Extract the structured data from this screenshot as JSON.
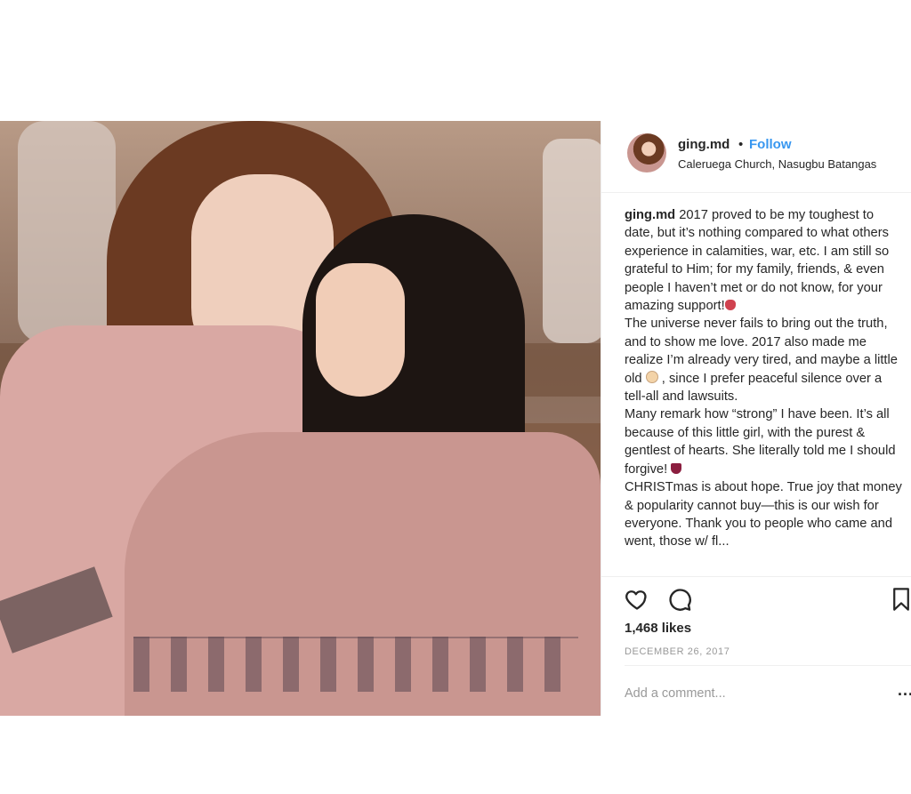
{
  "post": {
    "username": "ging.md",
    "separator": "•",
    "follow_label": "Follow",
    "location": "Caleruega Church, Nasugbu Batangas",
    "caption": {
      "username": "ging.md",
      "p1": "2017 proved to be my toughest to date, but it’s nothing compared to what others experience in calamities, war, etc. I am still so grateful to Him; for my family, friends, & even people I haven’t met or do not know, for your amazing support!",
      "p2": "The universe never fails to bring out the truth, and to show me love. 2017 also made me realize I’m already very tired, and maybe a little old",
      "p3": ", since I prefer peaceful silence over a tell-all and lawsuits.",
      "p4": "Many remark how “strong” I have been. It’s all because of this little girl, with the purest & gentlest of hearts. She literally told me I should forgive!",
      "p5": "CHRISTmas is about hope. True joy that money & popularity cannot buy—this is our wish for everyone. Thank you to people who came and went, those w/ fl..."
    },
    "likes": "1,468 likes",
    "date": "DECEMBER 26, 2017",
    "comment_placeholder": "Add a comment...",
    "more_label": "..."
  },
  "icons": {
    "heart": "heart-icon",
    "comment": "comment-icon",
    "save": "bookmark-icon",
    "more": "more-options-icon"
  },
  "colors": {
    "link": "#3897f0",
    "text": "#262626",
    "muted": "#999999",
    "divider": "#efefef"
  }
}
